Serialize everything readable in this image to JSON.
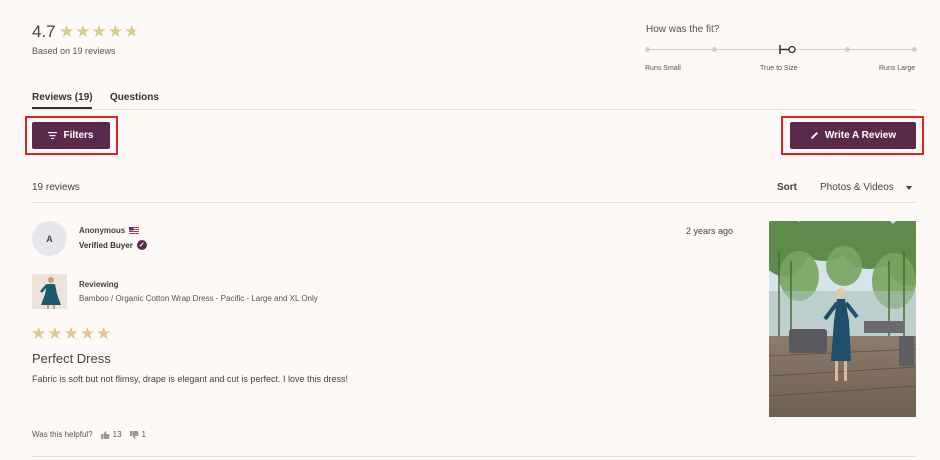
{
  "summary": {
    "rating": "4.7",
    "stars": 4.7,
    "based_on": "Based on 19 reviews"
  },
  "fit": {
    "question": "How was the fit?",
    "labels": {
      "small": "Runs Small",
      "true": "True to Size",
      "large": "Runs Large"
    },
    "level": 0.5
  },
  "tabs": [
    {
      "label": "Reviews (19)",
      "active": true
    },
    {
      "label": "Questions",
      "active": false
    }
  ],
  "toolbar": {
    "filters_label": "Filters",
    "write_label": "Write A Review"
  },
  "list": {
    "count": "19 reviews",
    "sort_label": "Sort",
    "sort_value": "Photos & Videos"
  },
  "review": {
    "avatar_initial": "A",
    "author": "Anonymous",
    "verified": "Verified Buyer",
    "date": "2 years ago",
    "reviewing_label": "Reviewing",
    "product": "Bamboo / Organic Cotton Wrap Dress - Pacific - Large and XL Only",
    "stars": 5,
    "title": "Perfect Dress",
    "body": "Fabric is soft but not flimsy, drape is elegant and cut is perfect. I love this dress!",
    "helpful_q": "Was this helpful?",
    "up_votes": "13",
    "down_votes": "1"
  },
  "colors": {
    "brand": "#5b2a4a",
    "star": "#dcc98b",
    "highlight_box": "#e3201b",
    "background": "#fdf9f6"
  },
  "icons": [
    "star-icon",
    "filter-icon",
    "pencil-icon",
    "us-flag-icon",
    "verified-check-icon",
    "thumbs-up-icon",
    "thumbs-down-icon",
    "caret-down-icon"
  ]
}
